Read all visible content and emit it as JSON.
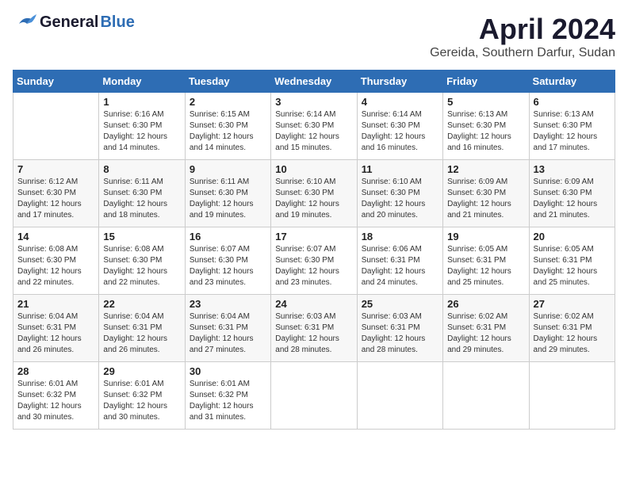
{
  "header": {
    "logo_general": "General",
    "logo_blue": "Blue",
    "month_title": "April 2024",
    "location": "Gereida, Southern Darfur, Sudan"
  },
  "weekdays": [
    "Sunday",
    "Monday",
    "Tuesday",
    "Wednesday",
    "Thursday",
    "Friday",
    "Saturday"
  ],
  "weeks": [
    [
      {
        "day": "",
        "sunrise": "",
        "sunset": "",
        "daylight": ""
      },
      {
        "day": "1",
        "sunrise": "Sunrise: 6:16 AM",
        "sunset": "Sunset: 6:30 PM",
        "daylight": "Daylight: 12 hours and 14 minutes."
      },
      {
        "day": "2",
        "sunrise": "Sunrise: 6:15 AM",
        "sunset": "Sunset: 6:30 PM",
        "daylight": "Daylight: 12 hours and 14 minutes."
      },
      {
        "day": "3",
        "sunrise": "Sunrise: 6:14 AM",
        "sunset": "Sunset: 6:30 PM",
        "daylight": "Daylight: 12 hours and 15 minutes."
      },
      {
        "day": "4",
        "sunrise": "Sunrise: 6:14 AM",
        "sunset": "Sunset: 6:30 PM",
        "daylight": "Daylight: 12 hours and 16 minutes."
      },
      {
        "day": "5",
        "sunrise": "Sunrise: 6:13 AM",
        "sunset": "Sunset: 6:30 PM",
        "daylight": "Daylight: 12 hours and 16 minutes."
      },
      {
        "day": "6",
        "sunrise": "Sunrise: 6:13 AM",
        "sunset": "Sunset: 6:30 PM",
        "daylight": "Daylight: 12 hours and 17 minutes."
      }
    ],
    [
      {
        "day": "7",
        "sunrise": "Sunrise: 6:12 AM",
        "sunset": "Sunset: 6:30 PM",
        "daylight": "Daylight: 12 hours and 17 minutes."
      },
      {
        "day": "8",
        "sunrise": "Sunrise: 6:11 AM",
        "sunset": "Sunset: 6:30 PM",
        "daylight": "Daylight: 12 hours and 18 minutes."
      },
      {
        "day": "9",
        "sunrise": "Sunrise: 6:11 AM",
        "sunset": "Sunset: 6:30 PM",
        "daylight": "Daylight: 12 hours and 19 minutes."
      },
      {
        "day": "10",
        "sunrise": "Sunrise: 6:10 AM",
        "sunset": "Sunset: 6:30 PM",
        "daylight": "Daylight: 12 hours and 19 minutes."
      },
      {
        "day": "11",
        "sunrise": "Sunrise: 6:10 AM",
        "sunset": "Sunset: 6:30 PM",
        "daylight": "Daylight: 12 hours and 20 minutes."
      },
      {
        "day": "12",
        "sunrise": "Sunrise: 6:09 AM",
        "sunset": "Sunset: 6:30 PM",
        "daylight": "Daylight: 12 hours and 21 minutes."
      },
      {
        "day": "13",
        "sunrise": "Sunrise: 6:09 AM",
        "sunset": "Sunset: 6:30 PM",
        "daylight": "Daylight: 12 hours and 21 minutes."
      }
    ],
    [
      {
        "day": "14",
        "sunrise": "Sunrise: 6:08 AM",
        "sunset": "Sunset: 6:30 PM",
        "daylight": "Daylight: 12 hours and 22 minutes."
      },
      {
        "day": "15",
        "sunrise": "Sunrise: 6:08 AM",
        "sunset": "Sunset: 6:30 PM",
        "daylight": "Daylight: 12 hours and 22 minutes."
      },
      {
        "day": "16",
        "sunrise": "Sunrise: 6:07 AM",
        "sunset": "Sunset: 6:30 PM",
        "daylight": "Daylight: 12 hours and 23 minutes."
      },
      {
        "day": "17",
        "sunrise": "Sunrise: 6:07 AM",
        "sunset": "Sunset: 6:30 PM",
        "daylight": "Daylight: 12 hours and 23 minutes."
      },
      {
        "day": "18",
        "sunrise": "Sunrise: 6:06 AM",
        "sunset": "Sunset: 6:31 PM",
        "daylight": "Daylight: 12 hours and 24 minutes."
      },
      {
        "day": "19",
        "sunrise": "Sunrise: 6:05 AM",
        "sunset": "Sunset: 6:31 PM",
        "daylight": "Daylight: 12 hours and 25 minutes."
      },
      {
        "day": "20",
        "sunrise": "Sunrise: 6:05 AM",
        "sunset": "Sunset: 6:31 PM",
        "daylight": "Daylight: 12 hours and 25 minutes."
      }
    ],
    [
      {
        "day": "21",
        "sunrise": "Sunrise: 6:04 AM",
        "sunset": "Sunset: 6:31 PM",
        "daylight": "Daylight: 12 hours and 26 minutes."
      },
      {
        "day": "22",
        "sunrise": "Sunrise: 6:04 AM",
        "sunset": "Sunset: 6:31 PM",
        "daylight": "Daylight: 12 hours and 26 minutes."
      },
      {
        "day": "23",
        "sunrise": "Sunrise: 6:04 AM",
        "sunset": "Sunset: 6:31 PM",
        "daylight": "Daylight: 12 hours and 27 minutes."
      },
      {
        "day": "24",
        "sunrise": "Sunrise: 6:03 AM",
        "sunset": "Sunset: 6:31 PM",
        "daylight": "Daylight: 12 hours and 28 minutes."
      },
      {
        "day": "25",
        "sunrise": "Sunrise: 6:03 AM",
        "sunset": "Sunset: 6:31 PM",
        "daylight": "Daylight: 12 hours and 28 minutes."
      },
      {
        "day": "26",
        "sunrise": "Sunrise: 6:02 AM",
        "sunset": "Sunset: 6:31 PM",
        "daylight": "Daylight: 12 hours and 29 minutes."
      },
      {
        "day": "27",
        "sunrise": "Sunrise: 6:02 AM",
        "sunset": "Sunset: 6:31 PM",
        "daylight": "Daylight: 12 hours and 29 minutes."
      }
    ],
    [
      {
        "day": "28",
        "sunrise": "Sunrise: 6:01 AM",
        "sunset": "Sunset: 6:32 PM",
        "daylight": "Daylight: 12 hours and 30 minutes."
      },
      {
        "day": "29",
        "sunrise": "Sunrise: 6:01 AM",
        "sunset": "Sunset: 6:32 PM",
        "daylight": "Daylight: 12 hours and 30 minutes."
      },
      {
        "day": "30",
        "sunrise": "Sunrise: 6:01 AM",
        "sunset": "Sunset: 6:32 PM",
        "daylight": "Daylight: 12 hours and 31 minutes."
      },
      {
        "day": "",
        "sunrise": "",
        "sunset": "",
        "daylight": ""
      },
      {
        "day": "",
        "sunrise": "",
        "sunset": "",
        "daylight": ""
      },
      {
        "day": "",
        "sunrise": "",
        "sunset": "",
        "daylight": ""
      },
      {
        "day": "",
        "sunrise": "",
        "sunset": "",
        "daylight": ""
      }
    ]
  ]
}
